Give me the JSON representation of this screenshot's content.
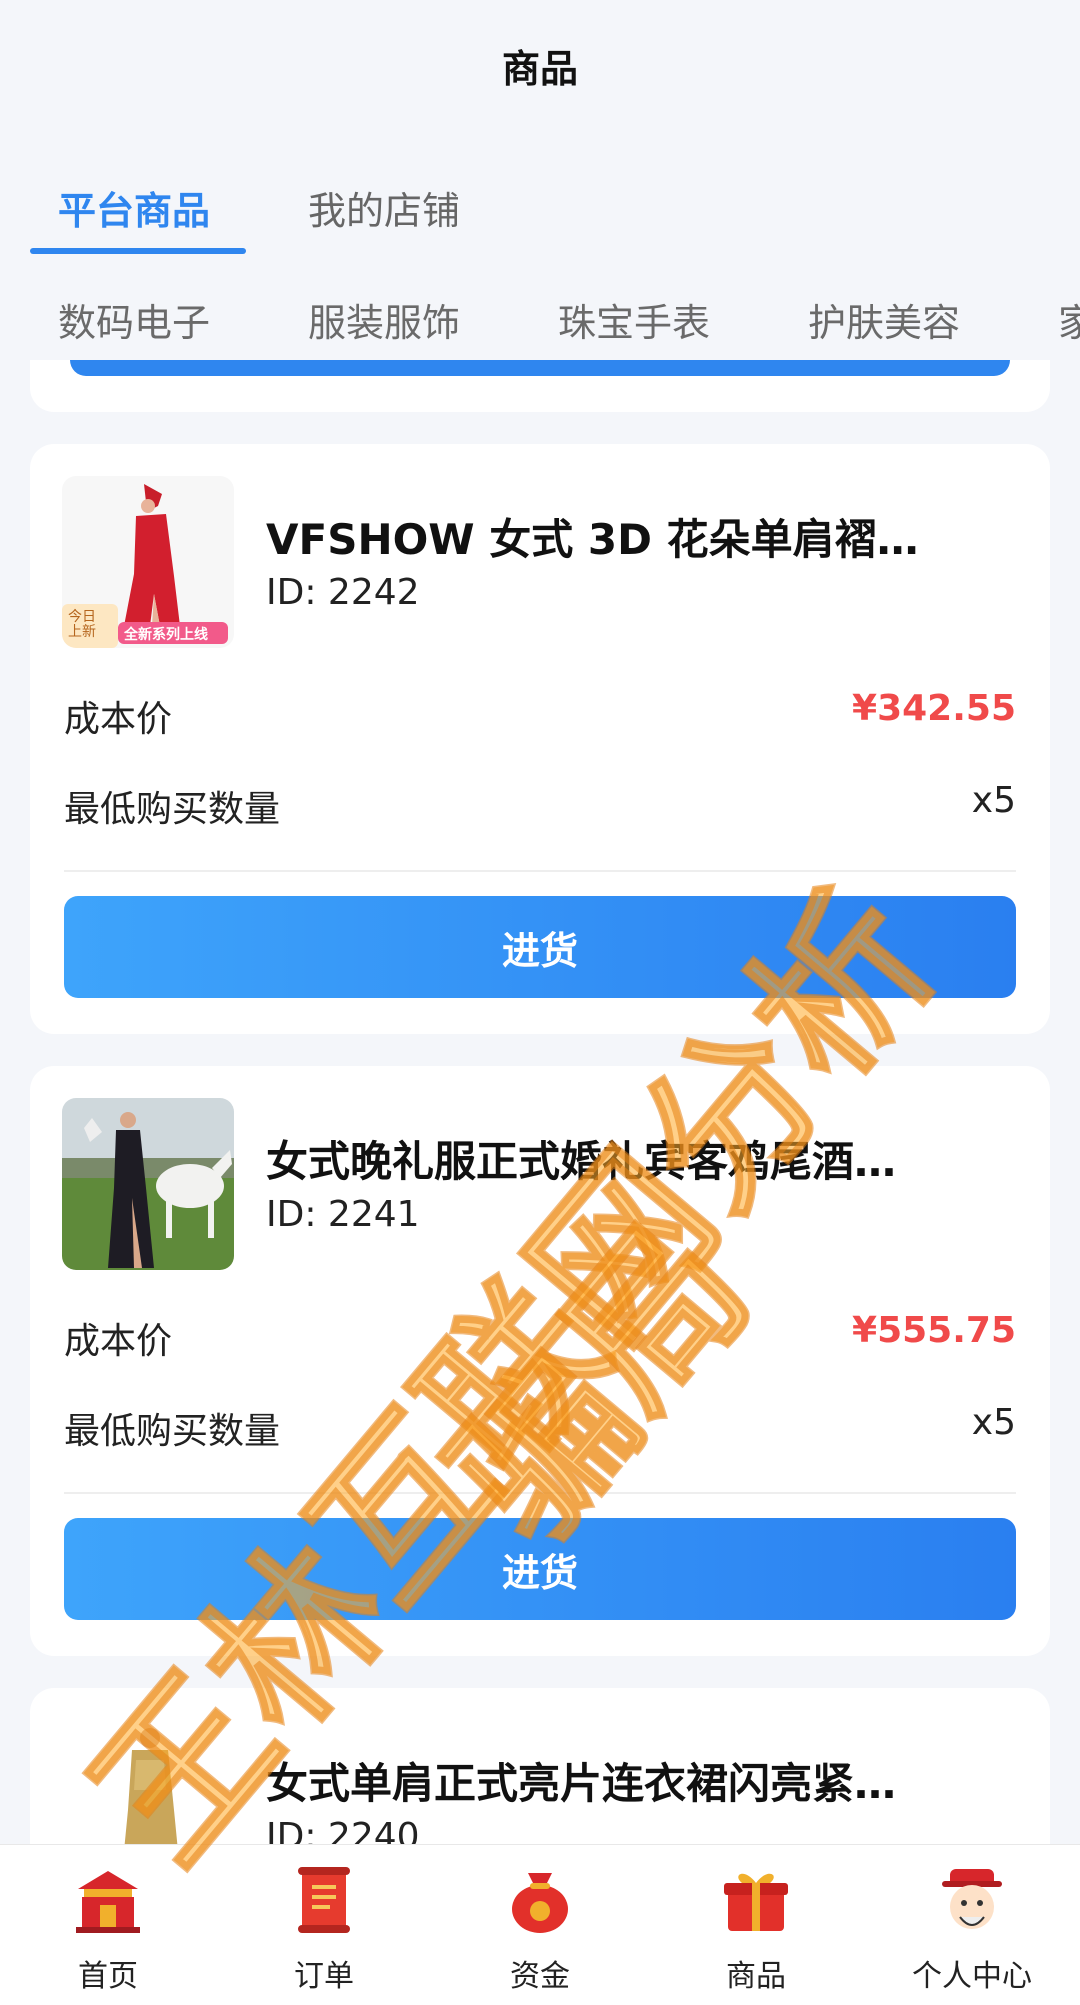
{
  "header": {
    "title": "商品"
  },
  "tabs": [
    {
      "label": "平台商品",
      "active": true
    },
    {
      "label": "我的店铺",
      "active": false
    }
  ],
  "categories": [
    "数码电子",
    "服装服饰",
    "珠宝手表",
    "护肤美容",
    "家"
  ],
  "labels": {
    "cost_price": "成本价",
    "min_qty": "最低购买数量",
    "buy_button": "进货"
  },
  "products": [
    {
      "title": "VFSHOW 女式 3D 花朵单肩褶…",
      "id": "ID: 2242",
      "price": "¥342.55",
      "min_qty": "x5",
      "thumb_badges": {
        "today": "今日\n上新",
        "series": "全新系列上线"
      }
    },
    {
      "title": "女式晚礼服正式婚礼宾客鸡尾酒…",
      "id": "ID: 2241",
      "price": "¥555.75",
      "min_qty": "x5"
    },
    {
      "title": "女式单肩正式亮片连衣裙闪亮紧…",
      "id": "ID: 2240"
    }
  ],
  "bottom_nav": [
    {
      "label": "首页",
      "icon": "temple-icon"
    },
    {
      "label": "订单",
      "icon": "scroll-icon"
    },
    {
      "label": "资金",
      "icon": "money-bag-icon"
    },
    {
      "label": "商品",
      "icon": "gift-box-icon"
    },
    {
      "label": "个人中心",
      "icon": "god-of-wealth-icon"
    }
  ],
  "watermark": {
    "line1": "王林互联网分析",
    "line2": "骗局"
  },
  "colors": {
    "accent": "#2f86ef",
    "price": "#f04a4a",
    "background": "#f4f6fa",
    "watermark": "#ffaa28"
  }
}
